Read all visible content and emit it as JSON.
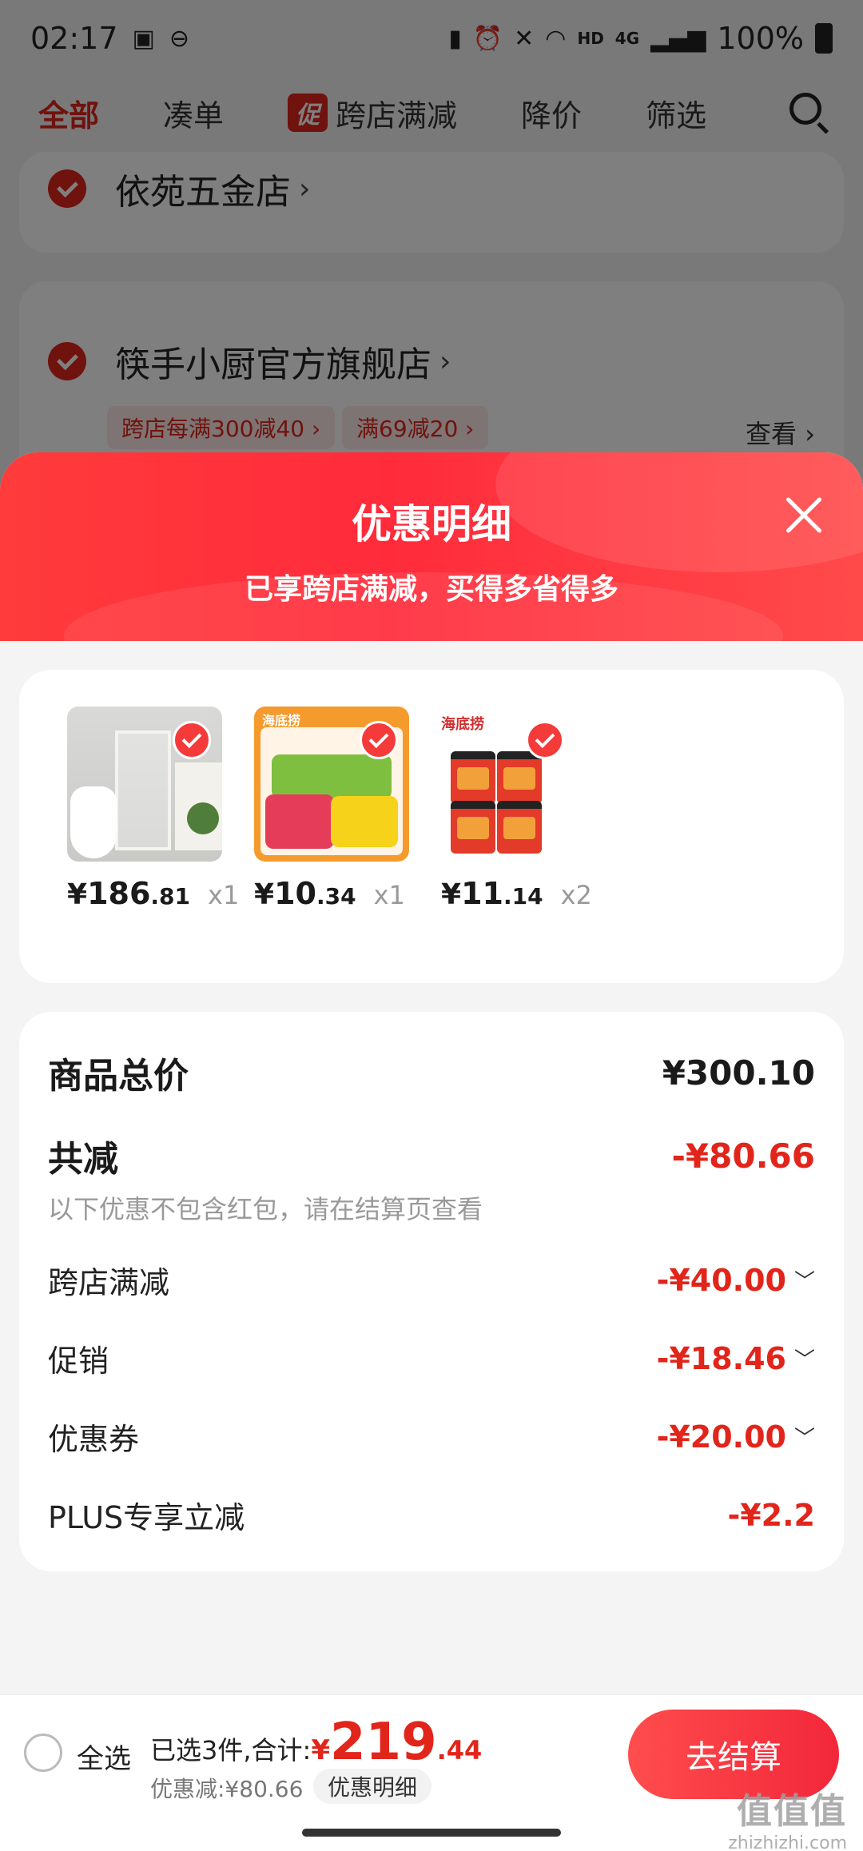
{
  "status_bar": {
    "time": "02:17",
    "network": "HD",
    "signal": "4G",
    "battery": "100%"
  },
  "top_tabs": [
    {
      "label": "全部",
      "active": true
    },
    {
      "label": "凑单",
      "active": false
    },
    {
      "label": "跨店满减",
      "badge": "促",
      "active": false
    },
    {
      "label": "降价",
      "active": false
    },
    {
      "label": "筛选",
      "active": false
    }
  ],
  "stores": [
    {
      "name": "依苑五金店"
    },
    {
      "name": "筷手小厨官方旗舰店",
      "promos": [
        "跨店每满300减40 ›",
        "满69减20 ›"
      ],
      "view_label": "查看 ›"
    }
  ],
  "sheet": {
    "title": "优惠明细",
    "subtitle": "已享跨店满减，买得多省得多"
  },
  "products": [
    {
      "price_int": "186",
      "price_dec": ".81",
      "qty": "x1",
      "yen": "¥"
    },
    {
      "price_int": "10",
      "price_dec": ".34",
      "qty": "x1",
      "yen": "¥",
      "brand": "海底捞"
    },
    {
      "price_int": "11",
      "price_dec": ".14",
      "qty": "x2",
      "yen": "¥",
      "brand": "海底捞"
    }
  ],
  "summary": {
    "total_label": "商品总价",
    "total_value": "¥300.10",
    "reduce_label": "共减",
    "reduce_value": "-¥80.66",
    "note": "以下优惠不包含红包，请在结算页查看",
    "lines": [
      {
        "label": "跨店满减",
        "value": "-¥40.00"
      },
      {
        "label": "促销",
        "value": "-¥18.46"
      },
      {
        "label": "优惠券",
        "value": "-¥20.00"
      },
      {
        "label": "PLUS专享立减",
        "value": "-¥2.2"
      }
    ]
  },
  "bottom_bar": {
    "select_all": "全选",
    "selected_prefix": "已选3件,合计:",
    "yen": "¥",
    "total_int": "219",
    "total_dec": ".44",
    "discount": "优惠减:¥80.66",
    "detail_label": "优惠明细",
    "checkout": "去结算"
  },
  "watermark": {
    "main": "值值值",
    "sub": "zhizhizhi.com"
  },
  "colors": {
    "accent": "#e1251b",
    "header_gradient": "#ff3b3b"
  }
}
